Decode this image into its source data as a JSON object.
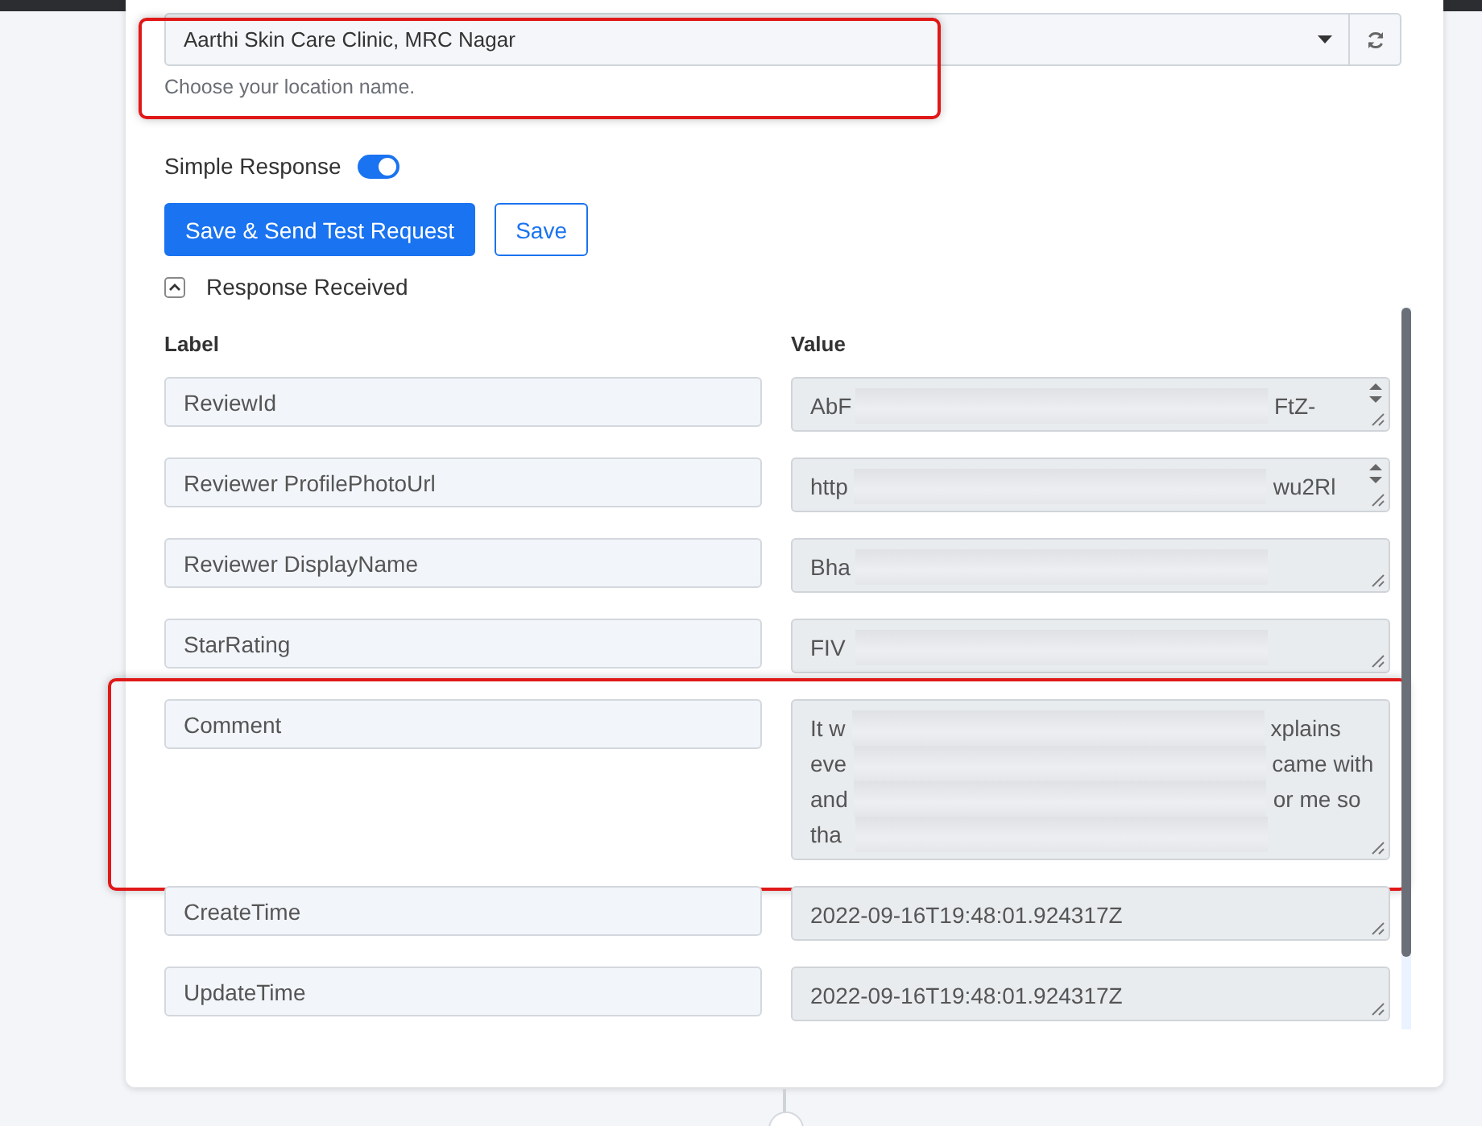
{
  "location_field": {
    "value": "Aarthi Skin Care Clinic, MRC Nagar",
    "help": "Choose your location name.",
    "highlighted": true
  },
  "simple_response": {
    "label": "Simple Response",
    "on": true
  },
  "buttons": [
    {
      "label": "Save & Send Test Request",
      "kind": "primary"
    },
    {
      "label": "Save",
      "kind": "outline"
    }
  ],
  "response_section": {
    "title": "Response Received",
    "expanded": true,
    "columns": [
      "Label",
      "Value"
    ],
    "rows": [
      {
        "label": "ReviewId",
        "redacted": true,
        "spinner": true,
        "highlighted": false,
        "value_lines": [
          {
            "start": "AbF",
            "end": "FtZ-"
          }
        ]
      },
      {
        "label": "Reviewer ProfilePhotoUrl",
        "redacted": true,
        "spinner": true,
        "highlighted": false,
        "value_lines": [
          {
            "start": "http",
            "end": "wu2Rl"
          }
        ]
      },
      {
        "label": "Reviewer DisplayName",
        "redacted": true,
        "spinner": false,
        "highlighted": false,
        "value_lines": [
          {
            "start": "Bha"
          }
        ]
      },
      {
        "label": "StarRating",
        "redacted": true,
        "spinner": false,
        "highlighted": false,
        "value_lines": [
          {
            "start": "FIV"
          }
        ]
      },
      {
        "label": "Comment",
        "redacted": true,
        "spinner": false,
        "highlighted": true,
        "value_lines": [
          {
            "start": "It w",
            "end": "xplains"
          },
          {
            "start": "eve",
            "end": "came with"
          },
          {
            "start": "and",
            "end": "or me so"
          },
          {
            "start": "tha"
          }
        ]
      },
      {
        "label": "CreateTime",
        "redacted": false,
        "spinner": false,
        "highlighted": false,
        "value_lines": [
          {
            "start": "2022-09-16T19:48:01.924317Z"
          }
        ]
      },
      {
        "label": "UpdateTime",
        "redacted": false,
        "spinner": false,
        "highlighted": false,
        "value_lines": [
          {
            "start": "2022-09-16T19:48:01.924317Z"
          }
        ]
      }
    ]
  }
}
